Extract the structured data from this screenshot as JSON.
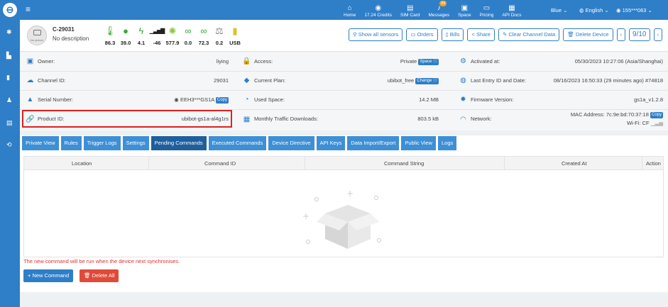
{
  "topbar": {
    "nav": [
      {
        "icon": "home-icon",
        "glyph": "⌂",
        "label": "Home"
      },
      {
        "icon": "coins-icon",
        "glyph": "◉",
        "label": "17.24 Credits"
      },
      {
        "icon": "sim-card-icon",
        "glyph": "▤",
        "label": "SIM Card"
      },
      {
        "icon": "bell-icon",
        "glyph": "♪",
        "label": "Messages",
        "badge": "99"
      },
      {
        "icon": "space-icon",
        "glyph": "▣",
        "label": "Space"
      },
      {
        "icon": "pricing-icon",
        "glyph": "▭",
        "label": "Pricing"
      },
      {
        "icon": "api-docs-icon",
        "glyph": "▦",
        "label": "API Docs"
      }
    ],
    "theme": "Blue",
    "language": "English",
    "user": "155***063"
  },
  "device": {
    "name": "C-29031",
    "description": "No description",
    "avatar_text": "No picture",
    "sensors": [
      {
        "icon": "thermometer-icon",
        "glyph": "🌡",
        "color": "#3aa83a",
        "value": "86.3"
      },
      {
        "icon": "humidity-drop-icon",
        "glyph": "●",
        "color": "#3aa83a",
        "value": "39.0"
      },
      {
        "icon": "voltage-icon",
        "glyph": "ϟ",
        "color": "#3aa83a",
        "value": "4.1"
      },
      {
        "icon": "signal-bars-icon",
        "glyph": "▁▃▅▇",
        "color": "#222222",
        "value": "-46"
      },
      {
        "icon": "light-sun-icon",
        "glyph": "✺",
        "color": "#8bc83a",
        "value": "577.9"
      },
      {
        "icon": "network-nodes-icon",
        "glyph": "∞",
        "color": "#3aa83a",
        "value": "0.0"
      },
      {
        "icon": "network-nodes-2-icon",
        "glyph": "∞",
        "color": "#3aa83a",
        "value": "72.3"
      },
      {
        "icon": "scale-icon",
        "glyph": "⚖",
        "color": "#888888",
        "value": "0.2"
      },
      {
        "icon": "usb-battery-icon",
        "glyph": "▮",
        "color": "#e0c020",
        "value": "USB"
      }
    ],
    "buttons": {
      "show_all_sensors": "Show all sensors",
      "orders": "Orders",
      "bills": "Bills",
      "share": "Share",
      "clear_channel_data": "Clear Channel Data",
      "delete_device": "Delete Device"
    },
    "pager": "9/10"
  },
  "info": {
    "owner": {
      "label": "Owner:",
      "value": "liying"
    },
    "access": {
      "label": "Access:",
      "value": "Private",
      "tag": "Space ⓘ"
    },
    "activated": {
      "label": "Activated at:",
      "value": "05/30/2023 10:27:06 (Asia/Shanghai)"
    },
    "channel_id": {
      "label": "Channel ID:",
      "value": "29031"
    },
    "current_plan": {
      "label": "Current Plan:",
      "value": "ubibot_free",
      "tag": "Change ⓘ"
    },
    "last_entry": {
      "label": "Last Entry ID and Date:",
      "value": "08/16/2023 16:50:33 (29 minutes ago) #74818"
    },
    "serial": {
      "label": "Serial Number:",
      "value": "EEH3***GS1A",
      "tag": "Copy"
    },
    "used_space": {
      "label": "Used Space:",
      "value": "14.2 MB"
    },
    "firmware": {
      "label": "Firmware Version:",
      "value": "gs1a_v1.2.8"
    },
    "product_id": {
      "label": "Product ID:",
      "value": "ubibot-gs1a-al4g1rs"
    },
    "traffic": {
      "label": "Monthly Traffic Downloads:",
      "value": "803.5 kB"
    },
    "network": {
      "label": "Network:",
      "mac": "MAC Address: 7c:9e:bd:70:37:18",
      "tag": "Copy",
      "wifi": "Wi-Fi: CF"
    }
  },
  "tabs": [
    "Private View",
    "Rules",
    "Trigger Logs",
    "Settings",
    "Pending Commands",
    "Executed Commands",
    "Device Directive",
    "API Keys",
    "Data Import/Export",
    "Public View",
    "Logs"
  ],
  "active_tab": "Pending Commands",
  "table": {
    "columns": [
      "Location",
      "Command ID",
      "Command String",
      "Created At",
      "Action"
    ]
  },
  "note": "The new command will be run when the device next synchronises.",
  "actions": {
    "new_command": "+ New Command",
    "delete_all": "🗑 Delete All"
  },
  "colors": {
    "primary": "#2f7ec8",
    "active_tab": "#1e5f9e",
    "danger": "#e04a3a",
    "highlight_box": "#e02020"
  }
}
